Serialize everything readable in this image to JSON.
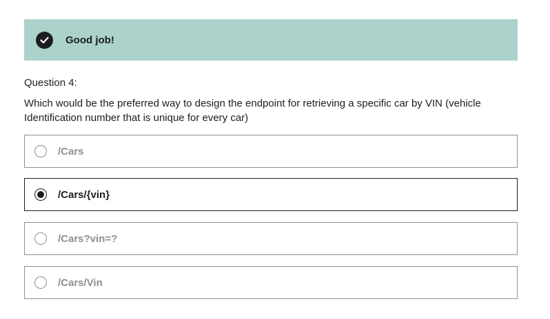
{
  "feedback": {
    "message": "Good job!",
    "icon": "check-circle-icon",
    "background_color": "#acd2cc"
  },
  "question": {
    "number_label": "Question 4:",
    "prompt": "Which would be the preferred way to design the endpoint for retrieving a specific car by VIN (vehicle Identification number that is unique for every car)"
  },
  "answers": [
    {
      "label": "/Cars",
      "selected": false
    },
    {
      "label": "/Cars/{vin}",
      "selected": true
    },
    {
      "label": "/Cars?vin=?",
      "selected": false
    },
    {
      "label": "/Cars/Vin",
      "selected": false
    }
  ]
}
